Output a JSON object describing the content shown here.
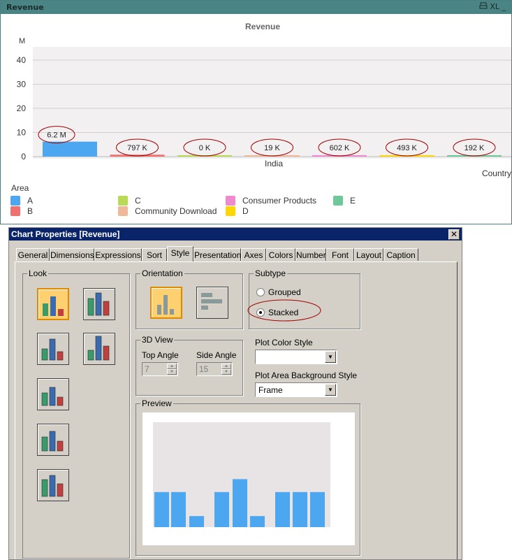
{
  "chart_window": {
    "title": "Revenue",
    "icons": [
      "print-icon",
      "excel-icon",
      "minimize-icon"
    ],
    "icon_text": "XL",
    "minimize_glyph": "_"
  },
  "chart_data": {
    "type": "bar",
    "title": "Revenue",
    "y_unit": "M",
    "ylim": [
      0,
      45
    ],
    "y_ticks": [
      "0",
      "10",
      "20",
      "30",
      "40"
    ],
    "categories": [
      "A",
      "B",
      "C",
      "Community Download",
      "Consumer Products",
      "D",
      "E"
    ],
    "values": [
      6.2,
      0.797,
      0.0,
      0.019,
      0.602,
      0.493,
      0.192
    ],
    "data_labels": [
      "6.2 M",
      "797 K",
      "0 K",
      "19 K",
      "602 K",
      "493 K",
      "192 K"
    ],
    "colors": [
      "#4da6f0",
      "#f07070",
      "#bada55",
      "#f0b898",
      "#f08ad0",
      "#ffd700",
      "#6ec89a"
    ],
    "x_group_label": "India",
    "x_dimension": "Country",
    "legend_title": "Area",
    "grid": true
  },
  "dialog": {
    "title": "Chart Properties [Revenue]",
    "close_glyph": "✕",
    "tabs": [
      "General",
      "Dimensions",
      "Expressions",
      "Sort",
      "Style",
      "Presentation",
      "Axes",
      "Colors",
      "Number",
      "Font",
      "Layout",
      "Caption"
    ],
    "active_tab": "Style",
    "look": {
      "label": "Look",
      "selected_index": 0,
      "count": 7
    },
    "orientation": {
      "label": "Orientation",
      "selected": "vertical"
    },
    "subtype": {
      "label": "Subtype",
      "options": [
        "Grouped",
        "Stacked"
      ],
      "selected": "Stacked"
    },
    "view3d": {
      "label": "3D View",
      "top_angle_label": "Top Angle",
      "top_angle": "7",
      "side_angle_label": "Side Angle",
      "side_angle": "15"
    },
    "plot_color_style": {
      "label": "Plot Color Style",
      "value": ""
    },
    "plot_area_bg": {
      "label": "Plot Area Background Style",
      "value": "Frame"
    },
    "preview": {
      "label": "Preview",
      "bars": [
        0.38,
        0.38,
        0.12,
        0.38,
        0.52,
        0.12,
        0.38,
        0.38,
        0.38
      ],
      "color": "#4da6f0"
    }
  }
}
